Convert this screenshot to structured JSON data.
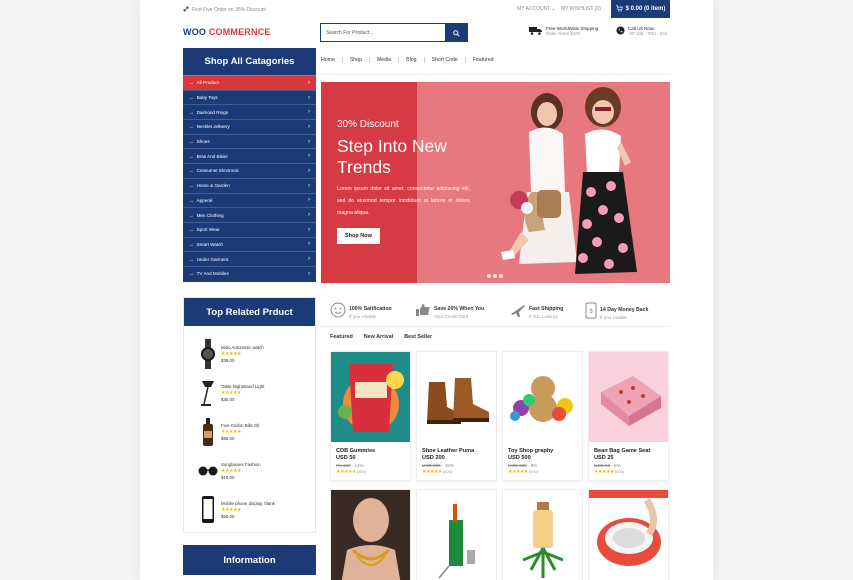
{
  "topbar": {
    "promo": "First Five Order on 35% Discount",
    "account": "MY ACCOUNT ⌄",
    "wishlist": "MY WISHLIST (0)",
    "cart": "$ 0.00 (0 item)"
  },
  "header": {
    "logo_woo": "WOO",
    "logo_com": "COMMERNCE",
    "search_placeholder": "Search For Product...",
    "shipping_title": "Free WorldWide Shipping",
    "shipping_sub": "Order Above $100",
    "call_title": "Call Us Now:",
    "call_sub": "+97 235 - 7881 - 934"
  },
  "categories": {
    "title": "Shop All Catagories",
    "items": [
      "All Product",
      "Baby Toys",
      "Daimond Rings",
      "Necklet Jellwery",
      "Shoes",
      "Bras And Bikini",
      "Consumer Electronic",
      "Home & Garden",
      "Apperal",
      "Men Clothing",
      "Sport Wear",
      "Smart Watch",
      "Under Garment",
      "TV And Mobiles"
    ]
  },
  "nav": [
    "Home",
    "Shop",
    "Media",
    "Blog",
    "Short Code",
    "Featured"
  ],
  "hero": {
    "discount": "30% Discount",
    "title": "Step Into New Trends",
    "description": "Lorem ipsum dolor sit amet, consectetur adipiscing elit, sed do eiusmod tempor incididunt ut labore et dolore magna aliqua.",
    "button": "Shop Now"
  },
  "related": {
    "title": "Top Related Prduct",
    "items": [
      {
        "name": "Mido Automatic watch",
        "stars": "★★★★★",
        "price": "$39.00"
      },
      {
        "name": "Table Nightstand Light",
        "stars": "★★★★★",
        "price": "$35.00"
      },
      {
        "name": "Five-Gallon Bills Oil",
        "stars": "★★★★★",
        "price": "$65.00"
      },
      {
        "name": "Sunglasses Fashion",
        "stars": "★★★★★",
        "price": "$10.00"
      },
      {
        "name": "Mobile phone display, blank",
        "stars": "★★★★★",
        "price": "$50.00"
      }
    ]
  },
  "information": {
    "title": "Information"
  },
  "benefits": [
    {
      "title": "100% Satification",
      "sub": "If you Unable",
      "icon": "smiley-icon"
    },
    {
      "title": "Save 20% When You",
      "sub": "Your Credit Card",
      "icon": "thumbs-up-icon"
    },
    {
      "title": "Fast Shipping",
      "sub": "If You Loab pc",
      "icon": "plane-icon"
    },
    {
      "title": "14 Day Money Back",
      "sub": "If you Unable",
      "icon": "phone-icon"
    }
  ],
  "tabs": [
    "Featured",
    "New Arrival",
    "Best Seller"
  ],
  "products": [
    {
      "name": "CDB Gummies",
      "price": "USD 50",
      "old_price": "Rs 150",
      "discount": "- 11%",
      "stars": "★★★★★",
      "reviews": "(500)"
    },
    {
      "name": "Shoe Leather Puma",
      "price": "USD 200",
      "old_price": "USD 350",
      "discount": "- 16%",
      "stars": "★★★★★",
      "reviews": "(500)"
    },
    {
      "name": "Toy Shop graphy",
      "price": "USD 500",
      "old_price": "USD 600",
      "discount": "- 8%",
      "stars": "★★★★★",
      "reviews": "(500)"
    },
    {
      "name": "Bean Bag Game Seat",
      "price": "USD 25",
      "old_price": "USD 50",
      "discount": "- 8%",
      "stars": "★★★★★",
      "reviews": "(500)"
    }
  ],
  "colors": {
    "primary": "#1d3a78",
    "accent": "#d8383c",
    "star": "#f4b400"
  }
}
